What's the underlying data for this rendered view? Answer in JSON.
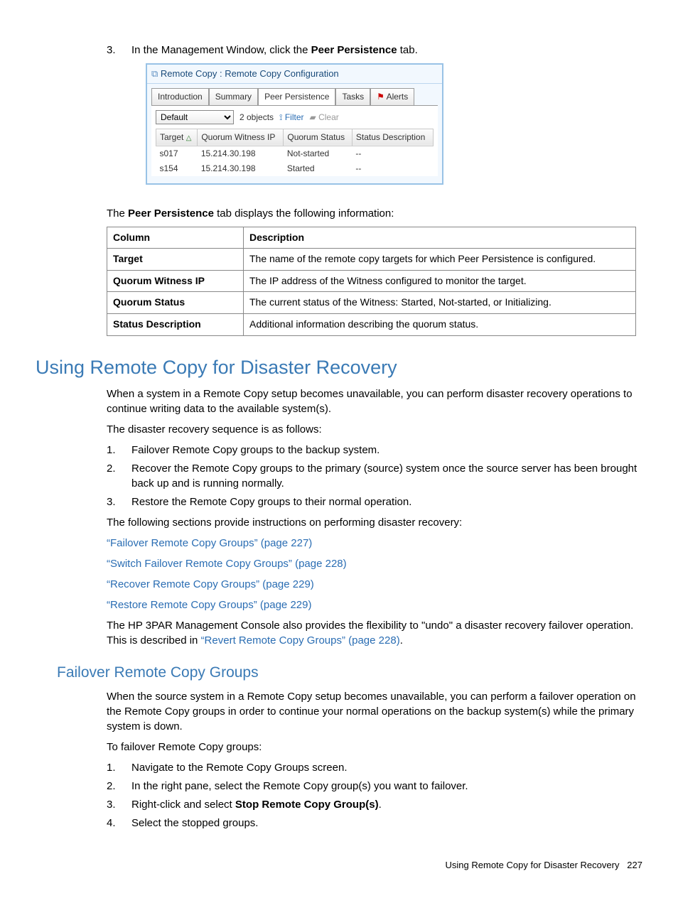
{
  "step3": {
    "num": "3.",
    "pre": "In the Management Window, click the ",
    "bold": "Peer Persistence",
    "post": " tab."
  },
  "screenshot": {
    "title": "Remote Copy : Remote Copy Configuration",
    "tabs": {
      "t1": "Introduction",
      "t2": "Summary",
      "t3": "Peer Persistence",
      "t4": "Tasks",
      "t5": "Alerts"
    },
    "toolbar": {
      "selected": "Default",
      "objects": "2 objects",
      "filter": "Filter",
      "clear": "Clear"
    },
    "headers": {
      "h1": "Target",
      "h2": "Quorum Witness IP",
      "h3": "Quorum Status",
      "h4": "Status Description"
    },
    "rows": [
      {
        "c1": "s017",
        "c2": "15.214.30.198",
        "c3": "Not-started",
        "c4": "--"
      },
      {
        "c1": "s154",
        "c2": "15.214.30.198",
        "c3": "Started",
        "c4": "--"
      }
    ]
  },
  "afterSS": {
    "pre": "The ",
    "bold": "Peer Persistence",
    "post": " tab displays the following information:"
  },
  "descTable": {
    "h1": "Column",
    "h2": "Description",
    "rows": [
      {
        "c1": "Target",
        "c2": "The name of the remote copy targets for which Peer Persistence is configured."
      },
      {
        "c1": "Quorum Witness IP",
        "c2": "The IP address of the Witness configured to monitor the target."
      },
      {
        "c1": "Quorum Status",
        "c2": "The current status of the Witness: Started, Not-started, or Initializing."
      },
      {
        "c1": "Status Description",
        "c2": "Additional information describing the quorum status."
      }
    ]
  },
  "section1": {
    "title": "Using Remote Copy for Disaster Recovery",
    "p1": "When a system in a Remote Copy setup becomes unavailable, you can perform disaster recovery operations to continue writing data to the available system(s).",
    "p2": "The disaster recovery sequence is as follows:",
    "list": [
      {
        "n": "1.",
        "t": "Failover Remote Copy groups to the backup system."
      },
      {
        "n": "2.",
        "t": "Recover the Remote Copy groups to the primary (source) system once the source server has been brought back up and is running normally."
      },
      {
        "n": "3.",
        "t": "Restore the Remote Copy groups to their normal operation."
      }
    ],
    "p3": "The following sections provide instructions on performing disaster recovery:",
    "links": [
      "“Failover Remote Copy Groups” (page 227)",
      "“Switch Failover Remote Copy Groups” (page 228)",
      "“Recover Remote Copy Groups” (page 229)",
      "“Restore Remote Copy Groups” (page 229)"
    ],
    "p4a": "The HP 3PAR Management Console also provides the flexibility to \"undo\" a disaster recovery failover operation. This is described in ",
    "p4link": "“Revert Remote Copy Groups” (page 228)",
    "p4b": "."
  },
  "section2": {
    "title": "Failover Remote Copy Groups",
    "p1": "When the source system in a Remote Copy setup becomes unavailable, you can perform a failover operation on the Remote Copy groups in order to continue your normal operations on the backup system(s) while the primary system is down.",
    "p2": "To failover Remote Copy groups:",
    "list": [
      {
        "n": "1.",
        "t": "Navigate to the Remote Copy Groups screen."
      },
      {
        "n": "2.",
        "t": "In the right pane, select the Remote Copy group(s) you want to failover."
      },
      {
        "n": "3.",
        "pre": "Right-click and select ",
        "bold": "Stop Remote Copy Group(s)",
        "post": "."
      },
      {
        "n": "4.",
        "t": "Select the stopped groups."
      }
    ]
  },
  "footer": {
    "text": "Using Remote Copy for Disaster Recovery",
    "page": "227"
  }
}
